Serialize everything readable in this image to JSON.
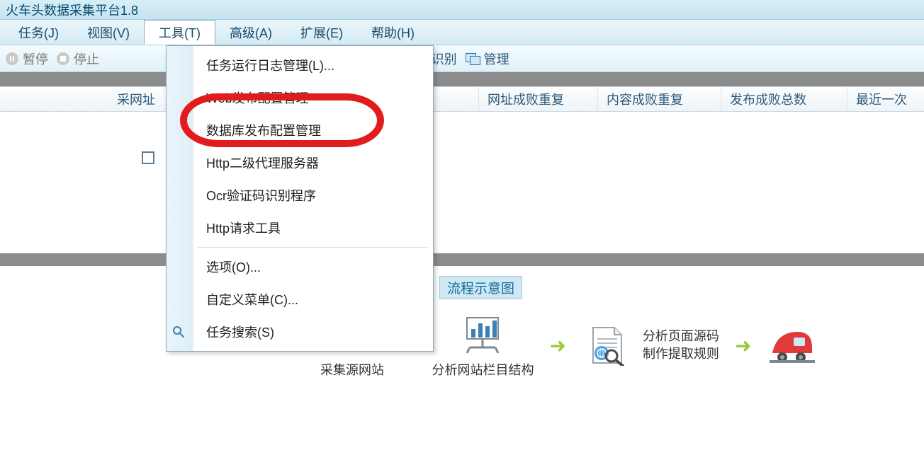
{
  "title": "火车头数据采集平台1.8",
  "menu": {
    "task": "任务(J)",
    "view": "视图(V)",
    "tools": "工具(T)",
    "advanced": "高级(A)",
    "extensions": "扩展(E)",
    "help": "帮助(H)"
  },
  "toolbar": {
    "pause": "暂停",
    "stop": "停止",
    "manage_suffix": "理",
    "ocr_label": "识别",
    "screens_label": "管理"
  },
  "columns": {
    "col1_partial": "采网址",
    "col2": "网址成败重复",
    "col3": "内容成败重复",
    "col4": "发布成败总数",
    "col5": "最近一次"
  },
  "dropdown": {
    "items": [
      "任务运行日志管理(L)...",
      "Web发布配置管理",
      "数据库发布配置管理",
      "Http二级代理服务器",
      "Ocr验证码识别程序",
      "Http请求工具"
    ],
    "options": "选项(O)...",
    "custom_menu": "自定义菜单(C)...",
    "task_search": "任务搜索(S)"
  },
  "flow": {
    "title_partial": "流程示意图",
    "step1": "采集源网站",
    "step2": "分析网站栏目结构",
    "step3a": "分析页面源码",
    "step3b": "制作提取规则"
  }
}
